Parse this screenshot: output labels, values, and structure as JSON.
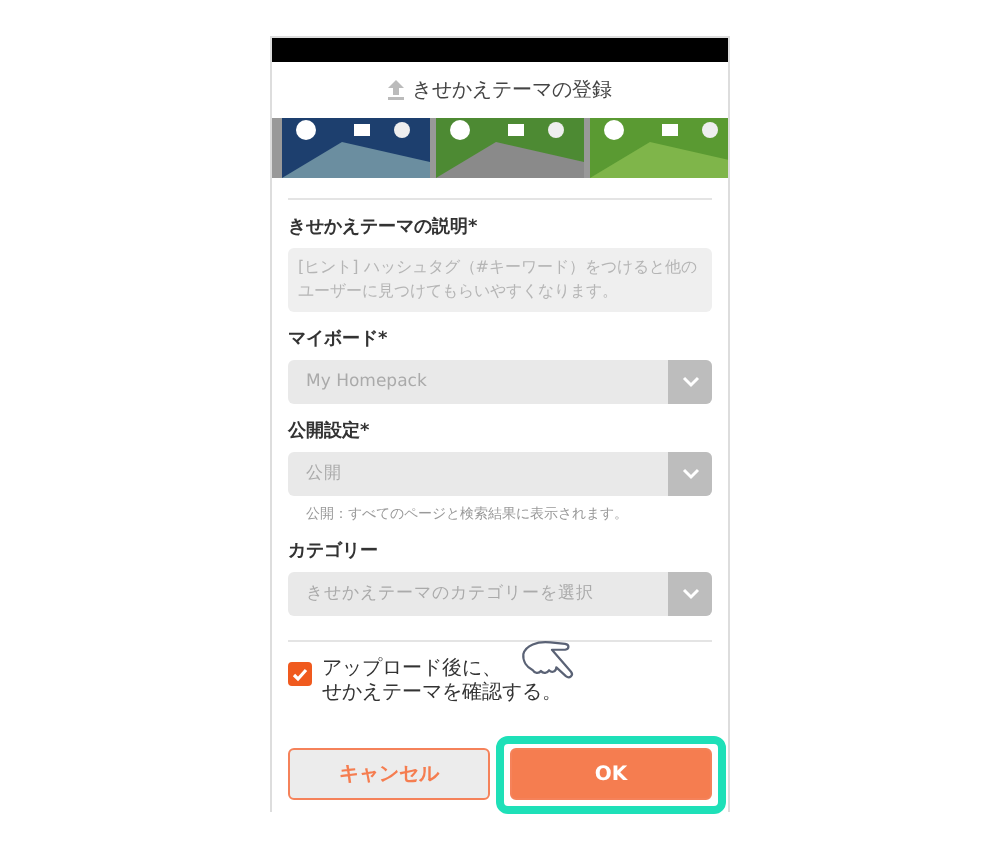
{
  "header": {
    "title": "きせかえテーマの登録"
  },
  "description": {
    "label": "きせかえテーマの説明*",
    "placeholder": "[ヒント] ハッシュタグ（#キーワード）をつけると他のユーザーに見つけてもらいやすくなります。"
  },
  "selects": [
    {
      "label": "マイボード*",
      "value": "My Homepack"
    },
    {
      "label": "公開設定*",
      "value": "公開",
      "hint": "公開：すべてのページと検索結果に表示されます。"
    },
    {
      "label": "カテゴリー",
      "value": "きせかえテーマのカテゴリーを選択"
    }
  ],
  "confirm": {
    "checked": true,
    "text_parts": [
      "アップロード後に、",
      "せかえテーマを確認する。"
    ]
  },
  "buttons": [
    {
      "label": "キャンセル",
      "kind": "secondary"
    },
    {
      "label": "OK",
      "kind": "primary",
      "highlighted": true
    }
  ]
}
